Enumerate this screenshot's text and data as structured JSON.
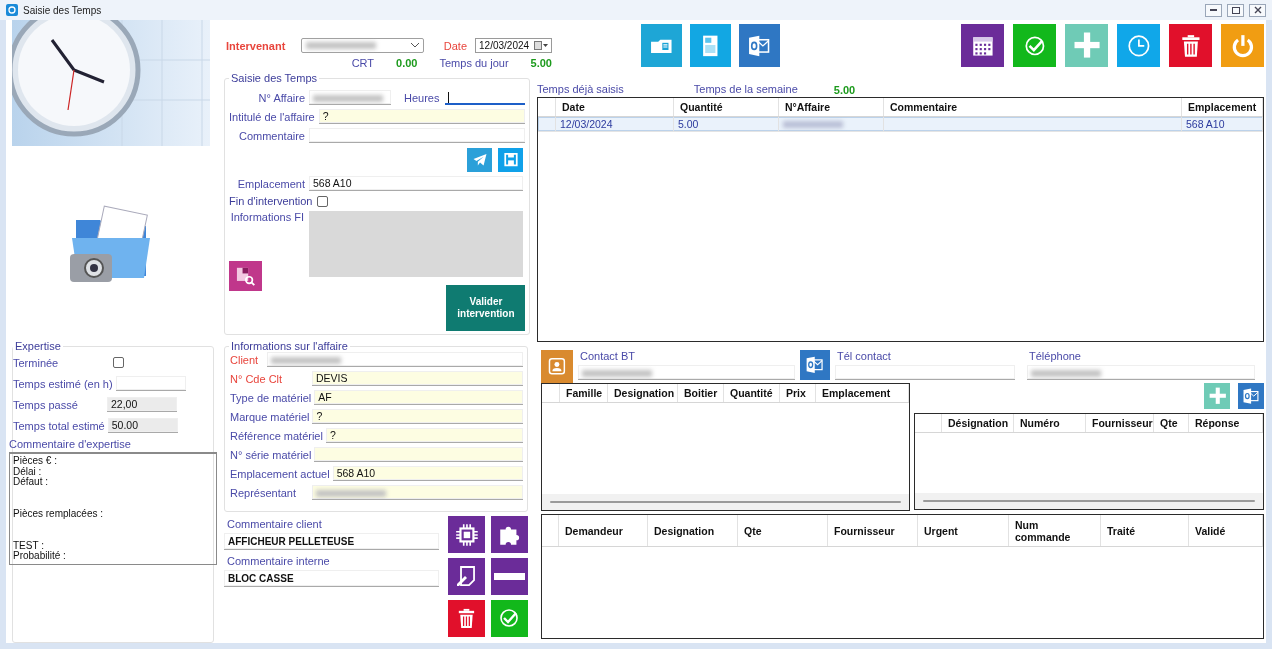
{
  "window": {
    "title": "Saisie des Temps"
  },
  "header": {
    "intervenant": {
      "label": "Intervenant",
      "redacted": true
    },
    "date": {
      "label": "Date",
      "value": "12/03/2024"
    },
    "crt": {
      "label": "CRT",
      "value": "0.00"
    },
    "temps_du_jour": {
      "label": "Temps du jour",
      "value": "5.00"
    }
  },
  "saisie_des_temps": {
    "title": "Saisie des Temps",
    "n_affaire": {
      "label": "N° Affaire",
      "redacted": true
    },
    "heures": {
      "label": "Heures",
      "focused": true
    },
    "intitule": {
      "label": "Intitulé de l'affaire",
      "value": "?",
      "highlight": true
    },
    "commentaire": {
      "label": "Commentaire"
    },
    "emplacement": {
      "label": "Emplacement",
      "value": "568 A10"
    },
    "fin_intervention": {
      "label": "Fin d'intervention",
      "checked": false
    },
    "informations_fi": {
      "label": "Informations FI"
    },
    "valider_button": "Valider intervention"
  },
  "expertise": {
    "title": "Expertise",
    "terminee": {
      "label": "Terminée",
      "checked": false
    },
    "fields": [
      {
        "label": "Temps estimé (en h)"
      },
      {
        "label": "Temps passé",
        "value": "22,00",
        "readonly": true
      },
      {
        "label": "Temps total estimé",
        "value": "50.00",
        "readonly": true
      }
    ],
    "commentaire": {
      "label": "Commentaire d'expertise",
      "value": "Pièces € :\nDélai :\nDéfaut :\n\n\nPièces remplacées :\n\n\nTEST :\nProbabilité :"
    }
  },
  "informations_affaire": {
    "title": "Informations sur l'affaire",
    "fields": [
      {
        "label": "Client",
        "kind": "compact",
        "required": true,
        "redacted": true
      },
      {
        "label": "N° Cde Clt",
        "kind": "normal",
        "required": true,
        "highlight": true,
        "value": "DEVIS"
      },
      {
        "label": "Type de matériel",
        "kind": "normal",
        "highlight": true,
        "value": "AF"
      },
      {
        "label": "Marque matériel",
        "kind": "normal",
        "highlight": true,
        "value": "?"
      },
      {
        "label": "Référence matériel",
        "kind": "normal",
        "highlight": true,
        "value": "?"
      },
      {
        "label": "N° série matériel",
        "kind": "normal",
        "highlight": true
      },
      {
        "label": "Emplacement actuel",
        "kind": "normal",
        "highlight": true,
        "value": "568 A10"
      },
      {
        "label": "Représentant",
        "kind": "normal",
        "highlight": true,
        "redacted": true
      }
    ]
  },
  "commentaire_client": {
    "label": "Commentaire client",
    "value": "AFFICHEUR PELLETEUSE"
  },
  "commentaire_interne": {
    "label": "Commentaire interne",
    "value": "BLOC CASSE"
  },
  "temps_deja_saisis": {
    "label": "Temps déjà saisis",
    "semaine_label": "Temps de la semaine",
    "semaine_value": "5.00",
    "table": {
      "columns": [
        "Date",
        "Quantité",
        "N°Affaire",
        "Commentaire",
        "Emplacement"
      ],
      "rows": [
        {
          "selected": true,
          "cells": [
            {
              "text": "12/03/2024"
            },
            {
              "text": "5.00"
            },
            {
              "redacted": true
            },
            {
              "redacted": false
            },
            {
              "text": "568 A10"
            }
          ]
        }
      ]
    }
  },
  "contact": {
    "contact_bt": {
      "label": "Contact BT",
      "redacted": true
    },
    "tel_contact": {
      "label": "Tél contact"
    },
    "telephone": {
      "label": "Téléphone",
      "redacted": true
    }
  },
  "pieces_table": {
    "columns": [
      "Famille",
      "Designation",
      "Boitier",
      "Quantité",
      "Prix",
      "Emplacement"
    ]
  },
  "reponses_table": {
    "columns": [
      "Désignation",
      "Numéro",
      "Fournisseur",
      "Qte",
      "Réponse"
    ]
  },
  "commandes_table": {
    "columns": [
      "Demandeur",
      "Designation",
      "Qte",
      "Fournisseur",
      "Urgent",
      "Num commande",
      "Traité",
      "Validé"
    ]
  }
}
